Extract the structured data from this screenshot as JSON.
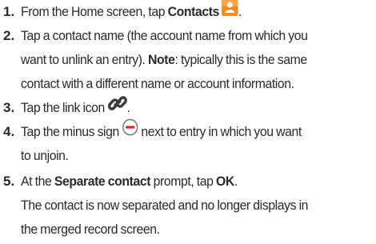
{
  "steps": [
    {
      "num": "1.",
      "pre": "From the Home screen, tap ",
      "bold": "Contacts",
      "post": ".",
      "icon": "contacts-app-icon",
      "icon_color": "#f08a24"
    },
    {
      "num": "2.",
      "line1": "Tap a contact name (the account name from which you",
      "line2_pre": "want to unlink an entry). ",
      "note_label": "Note",
      "line2_post": ": typically this is the same",
      "line3": "contact with a different name or account information."
    },
    {
      "num": "3.",
      "pre": "Tap the link icon ",
      "post": ".",
      "icon": "link-icon"
    },
    {
      "num": "4.",
      "line1_pre": "Tap the minus sign ",
      "line1_post": " next to entry in which you want",
      "line2": "to unjoin.",
      "icon": "minus-circle-icon",
      "icon_color": "#e0232a"
    },
    {
      "num": "5.",
      "pre": "At the ",
      "bold1": "Separate contact",
      "mid": " prompt, tap ",
      "bold2": "OK",
      "post": ".",
      "result_line1": "The contact is now separated and no longer displays in",
      "result_line2": "the merged record screen."
    }
  ]
}
